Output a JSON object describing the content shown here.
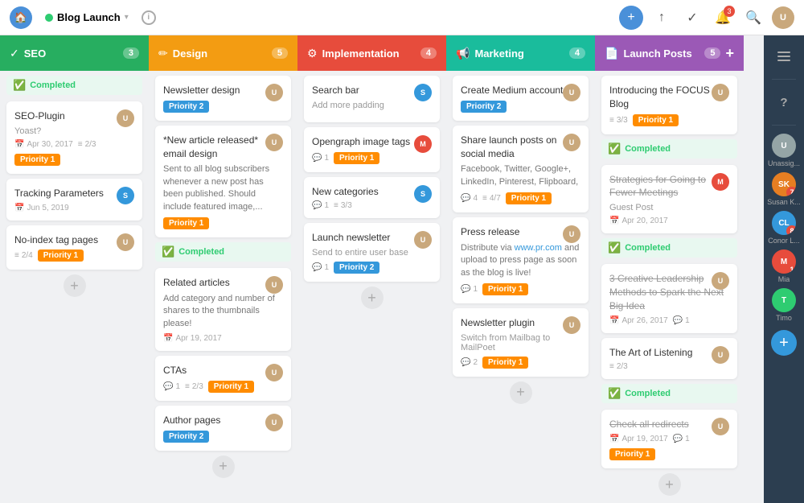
{
  "topnav": {
    "home_icon": "🏠",
    "project_name": "Blog Launch",
    "info": "i",
    "icons": {
      "add": "+",
      "upload": "↑",
      "check": "✓",
      "bell": "🔔",
      "search": "🔍"
    },
    "notification_count": "3"
  },
  "columns": [
    {
      "id": "seo",
      "title": "SEO",
      "color": "#27ae60",
      "count": "3",
      "icon": "✓",
      "cards": [
        {
          "id": "seo-completed-header",
          "type": "completed-section",
          "label": "Completed"
        },
        {
          "id": "seo-plugin",
          "title": "SEO-Plugin",
          "subtitle": "Yoast?",
          "date": "Apr 30, 2017",
          "progress": "2/3",
          "badge": "Priority 1",
          "badge_type": "p1",
          "avatar": "U"
        },
        {
          "id": "tracking-params",
          "title": "Tracking Parameters",
          "date": "Jun 5, 2019",
          "avatar": "S"
        },
        {
          "id": "no-index",
          "title": "No-index tag pages",
          "progress": "2/4",
          "badge": "Priority 1",
          "badge_type": "p1",
          "avatar": "U"
        }
      ]
    },
    {
      "id": "design",
      "title": "Design",
      "color": "#f39c12",
      "count": "5",
      "icon": "✏",
      "cards": [
        {
          "id": "newsletter-design",
          "title": "Newsletter design",
          "badge": "Priority 2",
          "badge_type": "p2",
          "avatar": "U"
        },
        {
          "id": "new-article-email",
          "title": "*New article released* email design",
          "desc": "Sent to all blog subscribers whenever a new post has been published. Should include featured image,...",
          "badge": "Priority 1",
          "badge_type": "p1",
          "avatar": "U"
        },
        {
          "id": "design-completed-header",
          "type": "completed-section",
          "label": "Completed"
        },
        {
          "id": "related-articles",
          "title": "Related articles",
          "desc": "Add category and number of shares to the thumbnails please!",
          "date": "Apr 19, 2017",
          "avatar": "U"
        },
        {
          "id": "ctas",
          "title": "CTAs",
          "comments": "1",
          "progress": "2/3",
          "badge": "Priority 1",
          "badge_type": "p1",
          "avatar": "U"
        },
        {
          "id": "author-pages",
          "title": "Author pages",
          "badge": "Priority 2",
          "badge_type": "p2",
          "avatar": "U"
        }
      ]
    },
    {
      "id": "implementation",
      "title": "Implementation",
      "color": "#e74c3c",
      "count": "4",
      "icon": "⚙",
      "cards": [
        {
          "id": "search-bar",
          "title": "Search bar",
          "subtitle": "Add more padding",
          "avatar": "S"
        },
        {
          "id": "opengraph",
          "title": "Opengraph image tags",
          "comments": "1",
          "badge": "Priority 1",
          "badge_type": "p1",
          "avatar": "M"
        },
        {
          "id": "new-categories",
          "title": "New categories",
          "comments": "1",
          "progress": "3/3",
          "avatar": "S"
        },
        {
          "id": "launch-newsletter",
          "title": "Launch newsletter",
          "subtitle": "Send to entire user base",
          "comments": "1",
          "badge": "Priority 2",
          "badge_type": "p2",
          "avatar": "U"
        }
      ]
    },
    {
      "id": "marketing",
      "title": "Marketing",
      "color": "#1abc9c",
      "count": "4",
      "icon": "📢",
      "cards": [
        {
          "id": "create-medium",
          "title": "Create Medium account",
          "badge": "Priority 2",
          "badge_type": "p2",
          "avatar": "U"
        },
        {
          "id": "share-launch",
          "title": "Share launch posts on social media",
          "desc": "Facebook, Twitter, Google+, LinkedIn, Pinterest, Flipboard,",
          "comments": "4",
          "progress": "4/7",
          "badge": "Priority 1",
          "badge_type": "p1",
          "avatar": "U"
        },
        {
          "id": "press-release",
          "title": "Press release",
          "desc": "Distribute via www.pr.com and upload to press page as soon as the blog is live!",
          "comments": "1",
          "badge": "Priority 1",
          "badge_type": "p1",
          "avatar": "U"
        },
        {
          "id": "newsletter-plugin",
          "title": "Newsletter plugin",
          "subtitle": "Switch from Mailbag to MailPoet",
          "comments": "2",
          "badge": "Priority 1",
          "badge_type": "p1",
          "avatar": "U"
        }
      ]
    },
    {
      "id": "launch-posts",
      "title": "Launch Posts",
      "color": "#9b59b6",
      "count": "5",
      "icon": "📄",
      "cards": [
        {
          "id": "introducing-focus",
          "title": "Introducing the FOCUS Blog",
          "progress": "3/3",
          "badge": "Priority 1",
          "badge_type": "p1",
          "avatar": "U"
        },
        {
          "id": "launch-completed-1",
          "type": "completed-section",
          "label": "Completed"
        },
        {
          "id": "strategies-fewer",
          "title": "Strategies for Going to Fewer Meetings",
          "title_strikethrough": true,
          "subtitle": "Guest Post",
          "date": "Apr 20, 2017",
          "avatar": "M"
        },
        {
          "id": "launch-completed-2",
          "type": "completed-section",
          "label": "Completed"
        },
        {
          "id": "creative-leadership",
          "title": "3 Creative Leadership Methods to Spark the Next Big Idea",
          "title_strikethrough": true,
          "date": "Apr 26, 2017",
          "comments": "1",
          "avatar": "U"
        },
        {
          "id": "art-of-listening",
          "title": "The Art of Listening",
          "progress": "2/3",
          "avatar": "U"
        },
        {
          "id": "launch-completed-3",
          "type": "completed-section",
          "label": "Completed"
        },
        {
          "id": "check-redirects",
          "title": "Check all redirects",
          "title_strikethrough": true,
          "date": "Apr 19, 2017",
          "comments": "1",
          "badge": "Priority 1",
          "badge_type": "p1",
          "avatar": "U"
        }
      ]
    }
  ],
  "sidebar": {
    "icons": {
      "question": "?",
      "add": "+"
    },
    "users": [
      {
        "label": "Unassig...",
        "color": "#95a5a6",
        "initials": "U"
      },
      {
        "label": "Susan K...",
        "color": "#e67e22",
        "initials": "SK",
        "badge": "7"
      },
      {
        "label": "Conor L...",
        "color": "#3498db",
        "initials": "CL",
        "badge": "8"
      },
      {
        "label": "Mia",
        "color": "#e74c3c",
        "initials": "M",
        "badge": "1"
      },
      {
        "label": "Timo",
        "color": "#2ecc71",
        "initials": "T"
      }
    ]
  },
  "labels": {
    "completed": "Completed",
    "add": "+",
    "priority1": "Priority 1",
    "priority2": "Priority 2"
  }
}
